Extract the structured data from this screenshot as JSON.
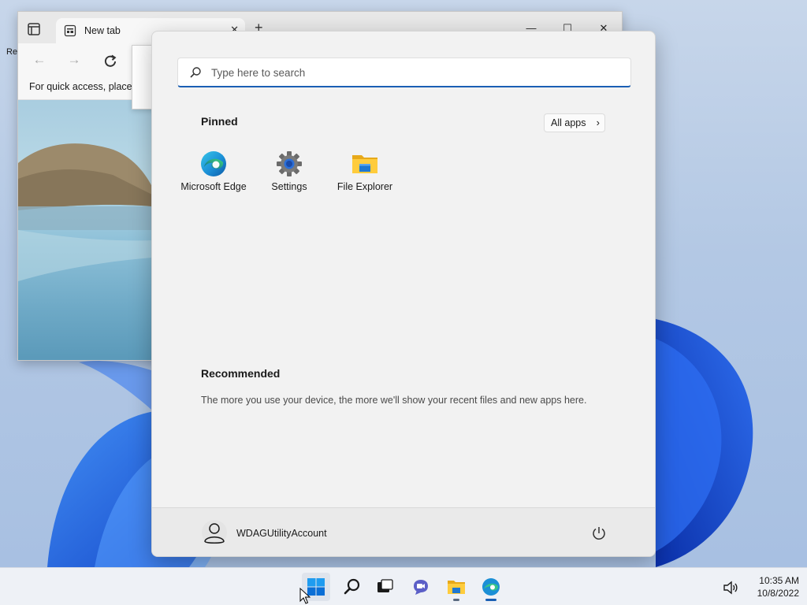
{
  "desktop": {
    "label_fragment": "Re"
  },
  "browser": {
    "tab_title": "New tab",
    "tab_close": "✕",
    "new_tab": "+",
    "favorites_bar_text": "For quick access, place y",
    "controls": {
      "minimize": "—",
      "maximize": "☐",
      "close": "✕"
    }
  },
  "start_menu": {
    "search_placeholder": "Type here to search",
    "pinned_title": "Pinned",
    "all_apps_label": "All apps",
    "all_apps_chevron": "›",
    "pinned_apps": [
      {
        "label": "Microsoft Edge",
        "icon": "edge-icon"
      },
      {
        "label": "Settings",
        "icon": "settings-gear-icon"
      },
      {
        "label": "File Explorer",
        "icon": "folder-icon"
      }
    ],
    "recommended_title": "Recommended",
    "recommended_text": "The more you use your device, the more we'll show your recent files and new apps here.",
    "user_name": "WDAGUtilityAccount"
  },
  "taskbar": {
    "items": [
      {
        "icon": "start-icon",
        "active": true
      },
      {
        "icon": "search-icon",
        "active": false
      },
      {
        "icon": "task-view-icon",
        "active": false
      },
      {
        "icon": "chat-icon",
        "active": false
      },
      {
        "icon": "file-explorer-icon",
        "active": false
      },
      {
        "icon": "edge-icon",
        "active": false
      }
    ],
    "clock": {
      "time": "10:35 AM",
      "date": "10/8/2022"
    }
  },
  "colors": {
    "accent": "#1a5fb4",
    "start_bg": "#f2f2f2",
    "taskbar_bg": "#eef1f6",
    "bloom_blue": "#1f5fe0"
  }
}
